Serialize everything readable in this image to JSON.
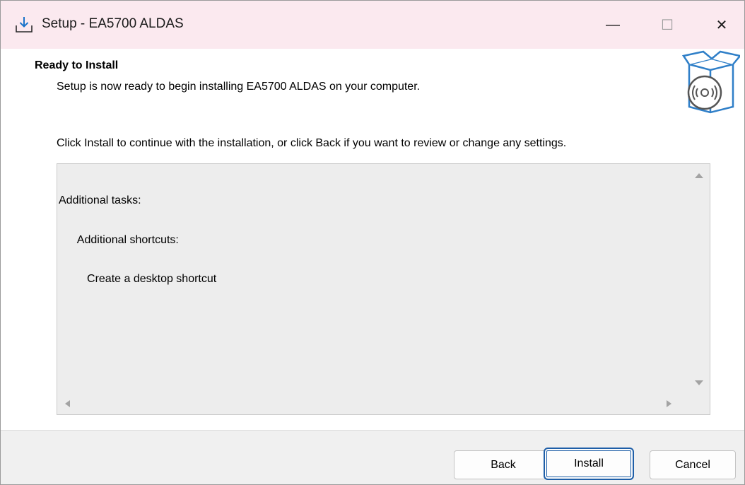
{
  "window": {
    "title": "Setup - EA5700 ALDAS",
    "minimize_icon": "minimize-icon",
    "maximize_icon": "maximize-icon",
    "close_icon": "close-icon",
    "minimize_glyph": "—",
    "maximize_glyph": "☐",
    "close_glyph": "✕"
  },
  "header": {
    "title": "Ready to Install",
    "subtitle": "Setup is now ready to begin installing EA5700 ALDAS on your computer."
  },
  "main": {
    "instruction": "Click Install to continue with the installation, or click Back if you want to review or change any settings.",
    "memo_lines": [
      "Additional tasks:",
      "      Additional shortcuts:",
      "         Create a desktop shortcut"
    ]
  },
  "buttons": {
    "back": "Back",
    "install": "Install",
    "cancel": "Cancel"
  },
  "colors": {
    "titlebar": "#fbe9ef",
    "memo_bg": "#ededed",
    "accent": "#1f5fa8",
    "footer_bg": "#f0f0f0"
  }
}
